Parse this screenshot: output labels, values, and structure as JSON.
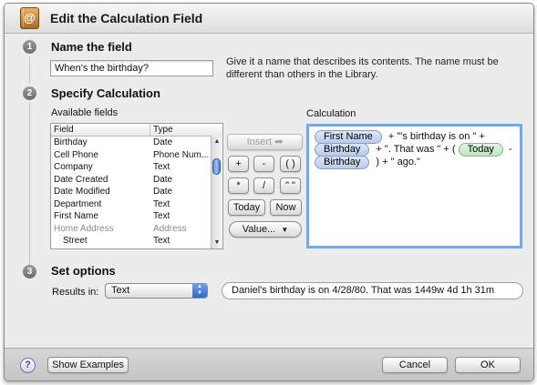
{
  "window": {
    "title": "Edit the Calculation Field",
    "app_icon": "address-book-icon"
  },
  "steps": [
    {
      "number": "1",
      "title": "Name the field"
    },
    {
      "number": "2",
      "title": "Specify Calculation"
    },
    {
      "number": "3",
      "title": "Set options"
    }
  ],
  "name_field": {
    "value": "When's the birthday?",
    "help_line1": "Give it a name that describes its contents. The name must be",
    "help_line2": "different than others in the Library."
  },
  "available_fields": {
    "label": "Available fields",
    "columns": [
      "Field",
      "Type"
    ],
    "rows": [
      {
        "field": "Birthday",
        "type": "Date"
      },
      {
        "field": "Cell Phone",
        "type": "Phone Num..."
      },
      {
        "field": "Company",
        "type": "Text"
      },
      {
        "field": "Date Created",
        "type": "Date"
      },
      {
        "field": "Date Modified",
        "type": "Date"
      },
      {
        "field": "Department",
        "type": "Text"
      },
      {
        "field": "First Name",
        "type": "Text"
      },
      {
        "field": "Home Address",
        "type": "Address"
      },
      {
        "field": "Street",
        "type": "Text"
      }
    ]
  },
  "buttons": {
    "insert": "Insert ➡",
    "plus": "+",
    "minus": "-",
    "parens": "( )",
    "multiply": "*",
    "divide": "/",
    "quotes": "\" \"",
    "today": "Today",
    "now": "Now",
    "value": "Value..."
  },
  "calculation": {
    "label": "Calculation",
    "token_first_name": "First Name",
    "text_1": "+ \"'s birthday is on \" +",
    "token_birthday_1": "Birthday",
    "text_2": "+ \". That was \" + (",
    "token_today": "Today",
    "text_3": "-",
    "token_birthday_2": "Birthday",
    "text_4": ") + \" ago.\""
  },
  "options": {
    "results_label": "Results in:",
    "results_value": "Text",
    "preview": "Daniel's birthday is on 4/28/80. That was 1449w 4d 1h 31m"
  },
  "footer": {
    "help": "?",
    "show_examples": "Show Examples",
    "cancel": "Cancel",
    "ok": "OK"
  },
  "colors": {
    "token_blue": "#b8ccef",
    "token_green": "#bfe5c0",
    "focus_ring": "#7aa7e0",
    "select_accent": "#2e6ad0"
  }
}
